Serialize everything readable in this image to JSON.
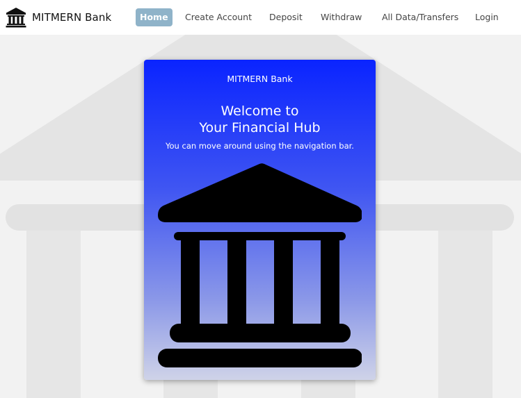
{
  "brand": {
    "name": "MITMERN Bank",
    "icon": "bank-icon"
  },
  "nav": {
    "items": [
      {
        "label": "Home",
        "active": true
      },
      {
        "label": "Create Account",
        "active": false
      },
      {
        "label": "Deposit",
        "active": false
      },
      {
        "label": "Withdraw",
        "active": false
      },
      {
        "label": "All Data/Transfers",
        "active": false
      },
      {
        "label": "Login",
        "active": false
      }
    ]
  },
  "card": {
    "header": "MITMERN Bank",
    "title_line1": "Welcome to",
    "title_line2": "Your Financial Hub",
    "text": "You can move around using the navigation bar.",
    "image_icon": "bank-icon"
  },
  "colors": {
    "active_nav_bg": "#8fb3c9",
    "card_gradient_top": "#0a24ff",
    "card_gradient_bottom": "#cfd3e8",
    "background": "#f2f2f2"
  }
}
